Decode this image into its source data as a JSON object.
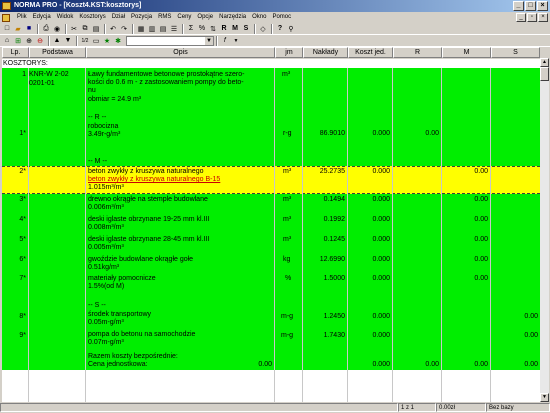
{
  "window": {
    "title": "NORMA PRO - [Koszt4.KST:kosztorys]"
  },
  "menu": [
    "Plik",
    "Edycja",
    "Widok",
    "Kosztorys",
    "Dział",
    "Pozycja",
    "RMS",
    "Ceny",
    "Opcje",
    "Narzędzia",
    "Okno",
    "Pomoc"
  ],
  "toolbar2": {
    "zoom": "1/2"
  },
  "columns": [
    "Lp.",
    "Podstawa",
    "Opis",
    "jm",
    "Nakłady",
    "Koszt jed.",
    "R",
    "M",
    "S"
  ],
  "section_label": "KOSZTORYS:",
  "rows": {
    "pos1_lp": "1",
    "pos1_base1": "KNR-W 2-02",
    "pos1_base2": "0201-01",
    "pos1_desc1": "Ławy fundamentowe betonowe prostokątne szero-",
    "pos1_desc2": "kości do 0.6 m - z zastosowaniem pompy do beto-",
    "pos1_desc3": "nu",
    "pos1_desc4": "obmiar  = 24.9 m³",
    "pos1_jm": "m³",
    "r_header": "-- R --",
    "r1_lp": "1*",
    "r1_desc1": "robocizna",
    "r1_desc2": "3.49r-g/m³",
    "r1_jm": "r-g",
    "r1_nakl": "86.9010",
    "r1_koszt": "0.000",
    "r1_r": "0.00",
    "m_header": "-- M --",
    "m2_lp": "2*",
    "m2_desc1": "beton zwykły z kruszywa naturalnego",
    "m2_desc2": "beton zwykły z kruszywa naturalnego B-15",
    "m2_desc3": "1.015m³/m³",
    "m2_jm": "m³",
    "m2_nakl": "25.2735",
    "m2_koszt": "0.000",
    "m2_m": "0.00",
    "m3_lp": "3*",
    "m3_desc1": "drewno okrągłe na stemple budowlane",
    "m3_desc2": "0.006m³/m³",
    "m3_jm": "m³",
    "m3_nakl": "0.1494",
    "m3_koszt": "0.000",
    "m3_m": "0.00",
    "m4_lp": "4*",
    "m4_desc1": "deski iglaste obrzynane 19-25 mm kl.III",
    "m4_desc2": "0.008m³/m³",
    "m4_jm": "m³",
    "m4_nakl": "0.1992",
    "m4_koszt": "0.000",
    "m4_m": "0.00",
    "m5_lp": "5*",
    "m5_desc1": "deski iglaste obrzynane 28-45 mm kl.III",
    "m5_desc2": "0.005m³/m³",
    "m5_jm": "m³",
    "m5_nakl": "0.1245",
    "m5_koszt": "0.000",
    "m5_m": "0.00",
    "m6_lp": "6*",
    "m6_desc1": "gwoździe budowlane okrągłe gołe",
    "m6_desc2": "0.51kg/m³",
    "m6_jm": "kg",
    "m6_nakl": "12.6990",
    "m6_koszt": "0.000",
    "m6_m": "0.00",
    "m7_lp": "7*",
    "m7_desc1": "materiały pomocnicze",
    "m7_desc2": "1.5%(od M)",
    "m7_jm": "%",
    "m7_nakl": "1.5000",
    "m7_koszt": "0.000",
    "m7_m": "0.00",
    "s_header": "-- S --",
    "s8_lp": "8*",
    "s8_desc1": "środek transportowy",
    "s8_desc2": "0.05m-g/m³",
    "s8_jm": "m-g",
    "s8_nakl": "1.2450",
    "s8_koszt": "0.000",
    "s8_s": "0.00",
    "s9_lp": "9*",
    "s9_desc1": "pompa do betonu na samochodzie",
    "s9_desc2": "0.07m-g/m³",
    "s9_jm": "m-g",
    "s9_nakl": "1.7430",
    "s9_koszt": "0.000",
    "s9_s": "0.00",
    "sum_label": "Razem koszty bezpośrednie:",
    "unit_label": "Cena jednostkowa:",
    "unit_val": "0.00",
    "sum_koszt": "0.000",
    "sum_r": "0.00",
    "sum_m": "0.00",
    "sum_s": "0.00"
  },
  "status": {
    "pos": "1 z 1",
    "value": "0.00zł",
    "db": "Bez bazy"
  },
  "colors": {
    "position_bg": "#00ee00",
    "selected_bg": "#ffff00",
    "title_start": "#0a246a"
  }
}
